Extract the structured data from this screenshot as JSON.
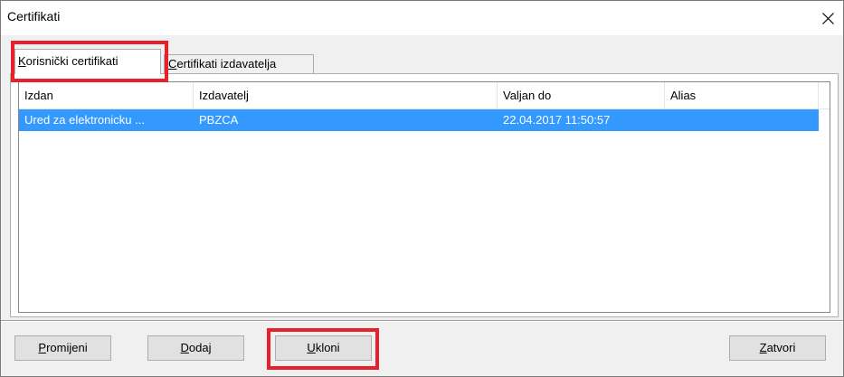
{
  "window": {
    "title": "Certifikati"
  },
  "tabs": [
    {
      "label": "Korisnički certifikati",
      "mnemonic": "K",
      "rest": "orisnički certifikati",
      "active": true
    },
    {
      "label": "Certifikati izdavatelja",
      "mnemonic": "C",
      "rest": "ertifikati izdavatelja",
      "active": false
    }
  ],
  "table": {
    "columns": [
      "Izdan",
      "Izdavatelj",
      "Valjan do",
      "Alias"
    ],
    "rows": [
      {
        "izdan": "Ured za elektronicku ...",
        "izdavatelj": "PBZCA",
        "valjan_do": "22.04.2017 11:50:57",
        "alias": "",
        "selected": true
      }
    ]
  },
  "buttons": {
    "promijeni": {
      "label": "Promijeni",
      "mnemonic": "P",
      "rest": "romijeni"
    },
    "dodaj": {
      "label": "Dodaj",
      "mnemonic": "D",
      "rest": "odaj"
    },
    "ukloni": {
      "label": "Ukloni",
      "mnemonic": "U",
      "rest": "kloni"
    },
    "zatvori": {
      "label": "Zatvori",
      "mnemonic": "Z",
      "rest": "atvori"
    }
  },
  "colors": {
    "selection": "#3399ff",
    "highlight_annotation": "#e8202a"
  }
}
